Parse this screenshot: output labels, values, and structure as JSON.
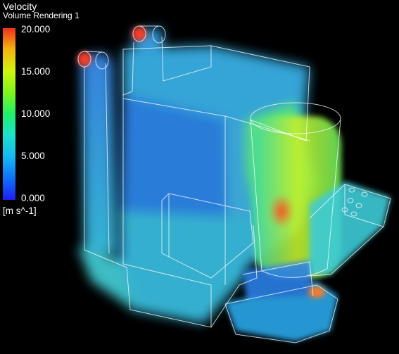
{
  "legend": {
    "variable": "Velocity",
    "subtitle": "Volume Rendering 1",
    "ticks": [
      "20.000",
      "15.000",
      "10.000",
      "5.000",
      "0.000"
    ],
    "units": "[m s^-1]"
  },
  "colors": {
    "background": "#000000",
    "low": "#1d1ef0",
    "mid": "#22ef6a",
    "high": "#f0301c"
  }
}
